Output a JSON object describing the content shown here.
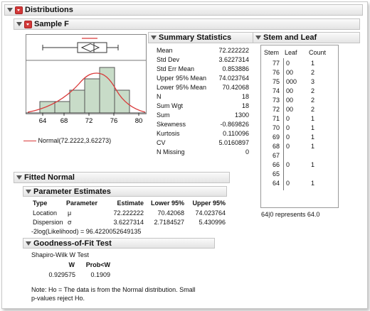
{
  "title": "Distributions",
  "sample": "Sample F",
  "legend_label": "Normal(72.2222,3.62273)",
  "hist_ticks": [
    "64",
    "68",
    "72",
    "76",
    "80"
  ],
  "summary": {
    "title": "Summary Statistics",
    "rows": [
      {
        "label": "Mean",
        "value": "72.222222"
      },
      {
        "label": "Std Dev",
        "value": "3.6227314"
      },
      {
        "label": "Std Err Mean",
        "value": "0.853886"
      },
      {
        "label": "Upper 95% Mean",
        "value": "74.023764"
      },
      {
        "label": "Lower 95% Mean",
        "value": "70.42068"
      },
      {
        "label": "N",
        "value": "18"
      },
      {
        "label": "Sum Wgt",
        "value": "18"
      },
      {
        "label": "Sum",
        "value": "1300"
      },
      {
        "label": "Skewness",
        "value": "-0.869826"
      },
      {
        "label": "Kurtosis",
        "value": "0.110096"
      },
      {
        "label": "CV",
        "value": "5.0160897"
      },
      {
        "label": "N Missing",
        "value": "0"
      }
    ]
  },
  "stem": {
    "title": "Stem and Leaf",
    "headers": [
      "Stem",
      "Leaf",
      "Count"
    ],
    "rows": [
      {
        "stem": "77",
        "leaf": "0",
        "count": "1"
      },
      {
        "stem": "76",
        "leaf": "00",
        "count": "2"
      },
      {
        "stem": "75",
        "leaf": "000",
        "count": "3"
      },
      {
        "stem": "74",
        "leaf": "00",
        "count": "2"
      },
      {
        "stem": "73",
        "leaf": "00",
        "count": "2"
      },
      {
        "stem": "72",
        "leaf": "00",
        "count": "2"
      },
      {
        "stem": "71",
        "leaf": "0",
        "count": "1"
      },
      {
        "stem": "70",
        "leaf": "0",
        "count": "1"
      },
      {
        "stem": "69",
        "leaf": "0",
        "count": "1"
      },
      {
        "stem": "68",
        "leaf": "0",
        "count": "1"
      },
      {
        "stem": "67",
        "leaf": "",
        "count": ""
      },
      {
        "stem": "66",
        "leaf": "0",
        "count": "1"
      },
      {
        "stem": "65",
        "leaf": "",
        "count": ""
      },
      {
        "stem": "64",
        "leaf": "0",
        "count": "1"
      }
    ],
    "note": "64|0 represents 64.0"
  },
  "fitted": {
    "title": "Fitted Normal",
    "param_title": "Parameter Estimates",
    "headers": [
      "Type",
      "Parameter",
      "Estimate",
      "Lower 95%",
      "Upper 95%"
    ],
    "rows": [
      {
        "type": "Location",
        "param": "μ",
        "est": "72.222222",
        "lo": "70.42068",
        "hi": "74.023764"
      },
      {
        "type": "Dispersion",
        "param": "σ",
        "est": "3.6227314",
        "lo": "2.7184527",
        "hi": "5.430996"
      }
    ],
    "loglik": "-2log(Likelihood) = 96.4220052649135"
  },
  "gof": {
    "title": "Goodness-of-Fit Test",
    "test_name": "Shapiro-Wilk W Test",
    "headers": [
      "W",
      "Prob<W"
    ],
    "values": [
      "0.929575",
      "0.1909"
    ],
    "note1": "Note: Ho = The data is from the Normal distribution. Small",
    "note2": "p-values reject Ho."
  },
  "colors": {
    "bar_fill": "#c8dcc8",
    "curve": "#d93a3a",
    "bracket": "#d93a3a"
  }
}
